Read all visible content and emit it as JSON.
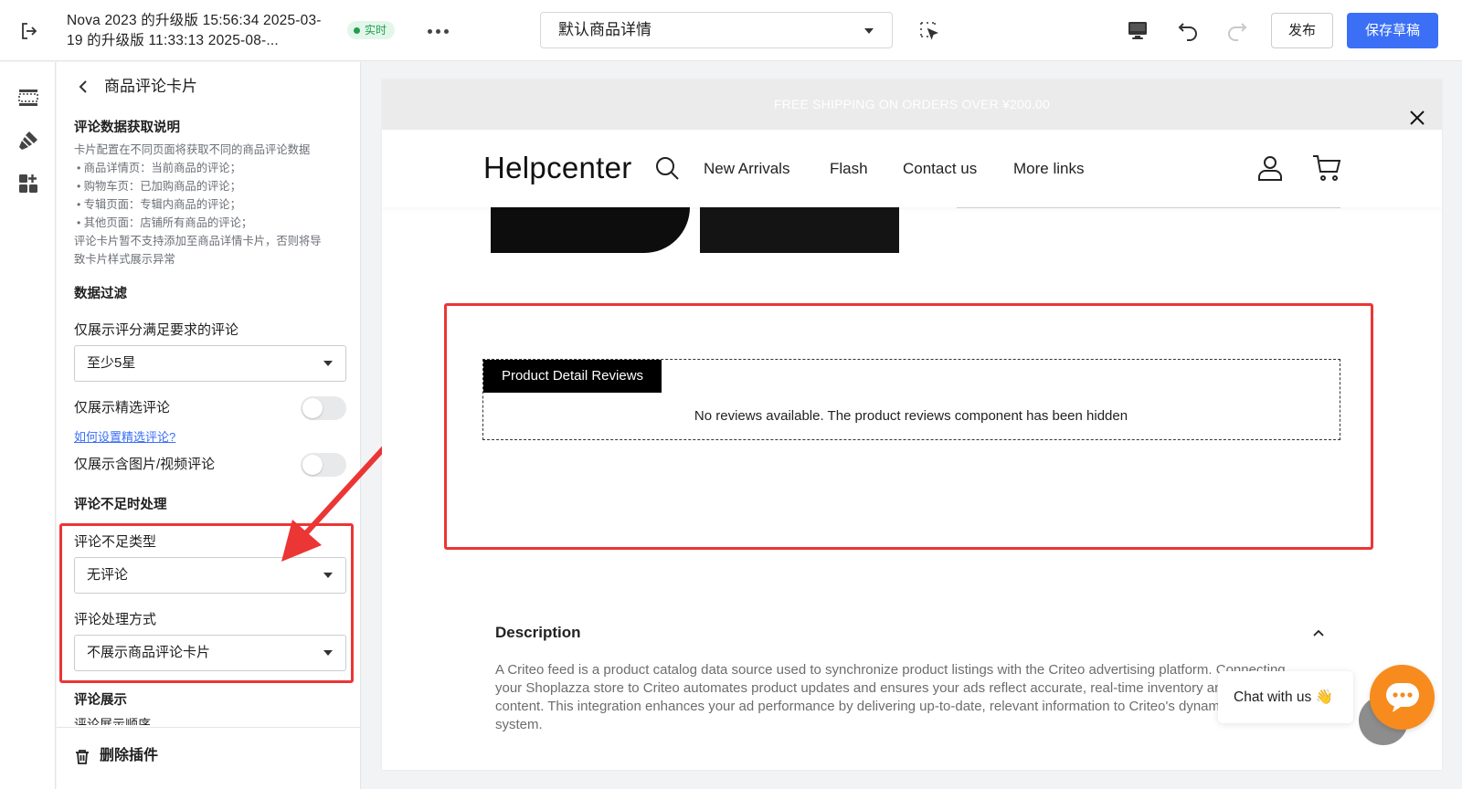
{
  "topbar": {
    "version_title": "Nova 2023 的升级版 15:56:34 2025-03-19 的升级版 11:33:13 2025-08-...",
    "live_label": "实时",
    "page_select": "默认商品详情",
    "publish_label": "发布",
    "save_label": "保存草稿"
  },
  "panel": {
    "title": "商品评论卡片",
    "data_section": {
      "title": "评论数据获取说明",
      "lines": [
        "卡片配置在不同页面将获取不同的商品评论数据",
        "• 商品详情页：当前商品的评论；",
        "• 购物车页：已加购商品的评论；",
        "• 专辑页面：专辑内商品的评论；",
        "• 其他页面：店铺所有商品的评论；",
        "评论卡片暂不支持添加至商品详情卡片，否则将导",
        "致卡片样式展示异常"
      ]
    },
    "filter": {
      "title": "数据过滤",
      "rating_label": "仅展示评分满足要求的评论",
      "rating_value": "至少5星",
      "featured_label": "仅展示精选评论",
      "featured_on": false,
      "featured_help": "如何设置精选评论?",
      "media_label": "仅展示含图片/视频评论",
      "media_on": false
    },
    "insufficient": {
      "title": "评论不足时处理",
      "type_label": "评论不足类型",
      "type_value": "无评论",
      "method_label": "评论处理方式",
      "method_value": "不展示商品评论卡片"
    },
    "display": {
      "title": "评论展示",
      "order_label": "评论展示顺序"
    },
    "delete_label": "删除插件"
  },
  "preview": {
    "announcement": "FREE SHIPPING ON ORDERS OVER ¥200.00",
    "logo": "Helpcenter",
    "nav": [
      "New Arrivals",
      "Flash",
      "Contact us",
      "More links"
    ],
    "reviews_tag": "Product Detail Reviews",
    "reviews_empty": "No reviews available. The product reviews component has been hidden",
    "description_title": "Description",
    "description_text": "A Criteo feed is a product catalog data source used to synchronize product listings with the Criteo advertising platform. Connecting your Shoplazza store to Criteo automates product updates and ensures your ads reflect accurate, real-time inventory and product content. This integration enhances your ad performance by delivering up-to-date, relevant information to Criteo's dynamic retargeting system."
  },
  "chat": {
    "label": "Chat with us 👋"
  },
  "colors": {
    "primary": "#3b6ff6",
    "highlight": "#ec3535",
    "live": "#1f9e4f",
    "chat": "#f78b1d"
  }
}
